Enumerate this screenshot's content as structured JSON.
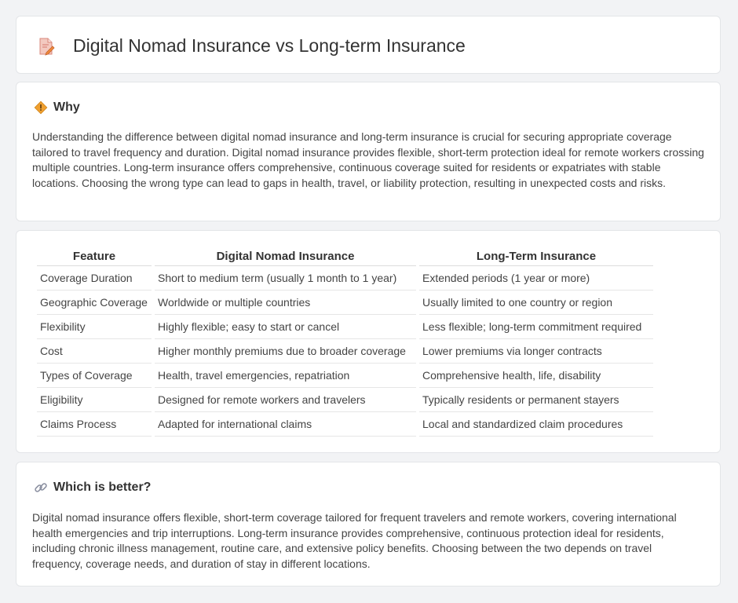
{
  "header": {
    "title": "Digital Nomad Insurance vs Long-term Insurance",
    "icon": "document-pen-icon"
  },
  "why": {
    "heading": "Why",
    "icon": "diamond-warning-icon",
    "text": "Understanding the difference between digital nomad insurance and long-term insurance is crucial for securing appropriate coverage tailored to travel frequency and duration. Digital nomad insurance provides flexible, short-term protection ideal for remote workers crossing multiple countries. Long-term insurance offers comprehensive, continuous coverage suited for residents or expatriates with stable locations. Choosing the wrong type can lead to gaps in health, travel, or liability protection, resulting in unexpected costs and risks."
  },
  "table": {
    "headers": [
      "Feature",
      "Digital Nomad Insurance",
      "Long-Term Insurance"
    ],
    "rows": [
      [
        "Coverage Duration",
        "Short to medium term (usually 1 month to 1 year)",
        "Extended periods (1 year or more)"
      ],
      [
        "Geographic Coverage",
        "Worldwide or multiple countries",
        "Usually limited to one country or region"
      ],
      [
        "Flexibility",
        "Highly flexible; easy to start or cancel",
        "Less flexible; long-term commitment required"
      ],
      [
        "Cost",
        "Higher monthly premiums due to broader coverage",
        "Lower premiums via longer contracts"
      ],
      [
        "Types of Coverage",
        "Health, travel emergencies, repatriation",
        "Comprehensive health, life, disability"
      ],
      [
        "Eligibility",
        "Designed for remote workers and travelers",
        "Typically residents or permanent stayers"
      ],
      [
        "Claims Process",
        "Adapted for international claims",
        "Local and standardized claim procedures"
      ]
    ]
  },
  "better": {
    "heading": "Which is better?",
    "icon": "link-icon",
    "text": "Digital nomad insurance offers flexible, short-term coverage tailored for frequent travelers and remote workers, covering international health emergencies and trip interruptions. Long-term insurance provides comprehensive, continuous protection ideal for residents, including chronic illness management, routine care, and extensive policy benefits. Choosing between the two depends on travel frequency, coverage needs, and duration of stay in different locations."
  },
  "colors": {
    "background": "#f2f3f5",
    "card": "#ffffff",
    "accent": "#f0a030"
  }
}
